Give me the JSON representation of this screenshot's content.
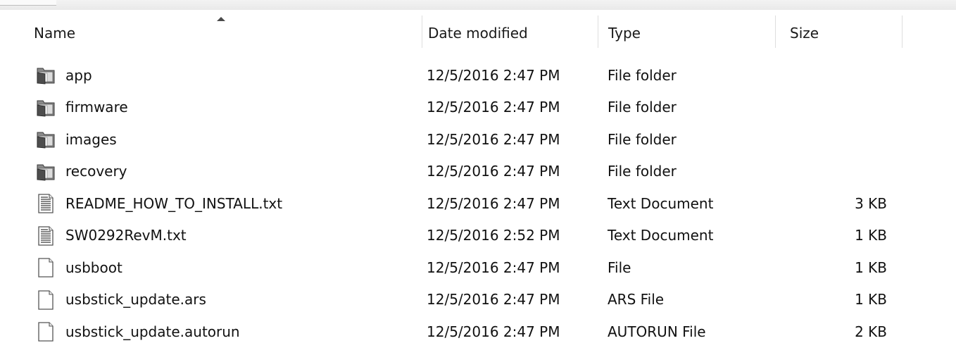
{
  "columns": {
    "name": "Name",
    "date_modified": "Date modified",
    "type": "Type",
    "size": "Size"
  },
  "files": [
    {
      "name": "app",
      "date": "12/5/2016 2:47 PM",
      "type": "File folder",
      "size": "",
      "icon": "folder-icon"
    },
    {
      "name": "firmware",
      "date": "12/5/2016 2:47 PM",
      "type": "File folder",
      "size": "",
      "icon": "folder-icon"
    },
    {
      "name": "images",
      "date": "12/5/2016 2:47 PM",
      "type": "File folder",
      "size": "",
      "icon": "folder-icon"
    },
    {
      "name": "recovery",
      "date": "12/5/2016 2:47 PM",
      "type": "File folder",
      "size": "",
      "icon": "folder-icon"
    },
    {
      "name": "README_HOW_TO_INSTALL.txt",
      "date": "12/5/2016 2:47 PM",
      "type": "Text Document",
      "size": "3 KB",
      "icon": "text-document-icon"
    },
    {
      "name": "SW0292RevM.txt",
      "date": "12/5/2016 2:52 PM",
      "type": "Text Document",
      "size": "1 KB",
      "icon": "text-document-icon"
    },
    {
      "name": "usbboot",
      "date": "12/5/2016 2:47 PM",
      "type": "File",
      "size": "1 KB",
      "icon": "file-icon"
    },
    {
      "name": "usbstick_update.ars",
      "date": "12/5/2016 2:47 PM",
      "type": "ARS File",
      "size": "1 KB",
      "icon": "file-icon"
    },
    {
      "name": "usbstick_update.autorun",
      "date": "12/5/2016 2:47 PM",
      "type": "AUTORUN File",
      "size": "2 KB",
      "icon": "file-icon"
    }
  ]
}
